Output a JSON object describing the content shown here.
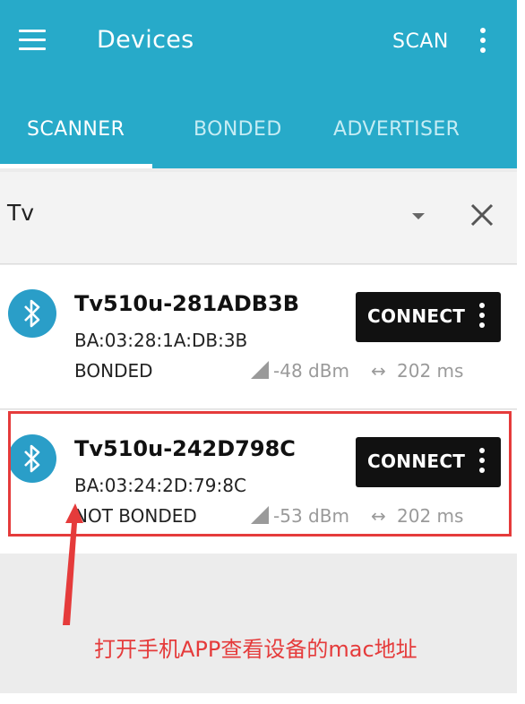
{
  "appbar": {
    "title": "Devices",
    "scan_label": "SCAN",
    "menu_icon": "hamburger-menu-icon",
    "overflow_icon": "more-vert-icon",
    "background_color": "#27aac9"
  },
  "tabs": [
    {
      "label": "SCANNER",
      "selected": true
    },
    {
      "label": "BONDED",
      "selected": false
    },
    {
      "label": "ADVERTISER",
      "selected": false
    }
  ],
  "filter": {
    "value": "Tv",
    "dropdown_icon": "arrow-drop-down-icon",
    "clear_icon": "close-icon"
  },
  "devices": [
    {
      "name": "Tv510u-281ADB3B",
      "mac": "BA:03:28:1A:DB:3B",
      "bond_state": "BONDED",
      "rssi": "-48 dBm",
      "interval": "202 ms",
      "connect_label": "CONNECT",
      "icon": "bluetooth-icon"
    },
    {
      "name": "Tv510u-242D798C",
      "mac": "BA:03:24:2D:79:8C",
      "bond_state": "NOT BONDED",
      "rssi": "-53 dBm",
      "interval": "202 ms",
      "connect_label": "CONNECT",
      "icon": "bluetooth-icon"
    }
  ],
  "annotation": {
    "text": "打开手机APP查看设备的mac地址",
    "color": "#e53b3b"
  }
}
